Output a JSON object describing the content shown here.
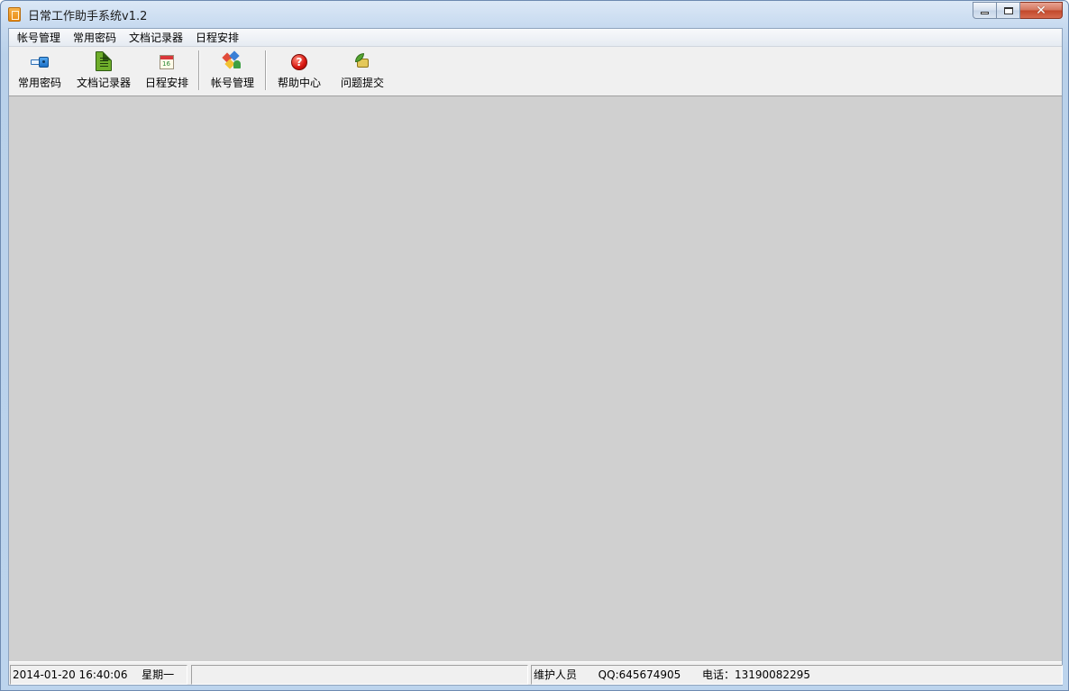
{
  "window": {
    "title": "日常工作助手系统v1.2",
    "caption_buttons": {
      "minimize": "—",
      "maximize": "□",
      "close": "✕"
    }
  },
  "menu": {
    "items": [
      {
        "label": "帐号管理"
      },
      {
        "label": "常用密码"
      },
      {
        "label": "文档记录器"
      },
      {
        "label": "日程安排"
      }
    ]
  },
  "toolbar": {
    "buttons": [
      {
        "label": "常用密码",
        "icon": "key-icon"
      },
      {
        "label": "文档记录器",
        "icon": "document-icon"
      },
      {
        "label": "日程安排",
        "icon": "calendar-icon"
      },
      {
        "label": "帐号管理",
        "icon": "users-icon"
      },
      {
        "label": "帮助中心",
        "icon": "help-icon"
      },
      {
        "label": "问题提交",
        "icon": "submit-icon"
      }
    ],
    "calendar_icon_number": "16"
  },
  "statusbar": {
    "datetime": "2014-01-20 16:40:06",
    "weekday": "星期一",
    "middle": "",
    "maintainer_label": "维护人员",
    "qq": "QQ:645674905",
    "phone": "电话：13190082295"
  },
  "colors": {
    "mdi_background": "#d0d0d0",
    "window_frame": "#bcd4ed",
    "client_background": "#f0f0f0"
  }
}
